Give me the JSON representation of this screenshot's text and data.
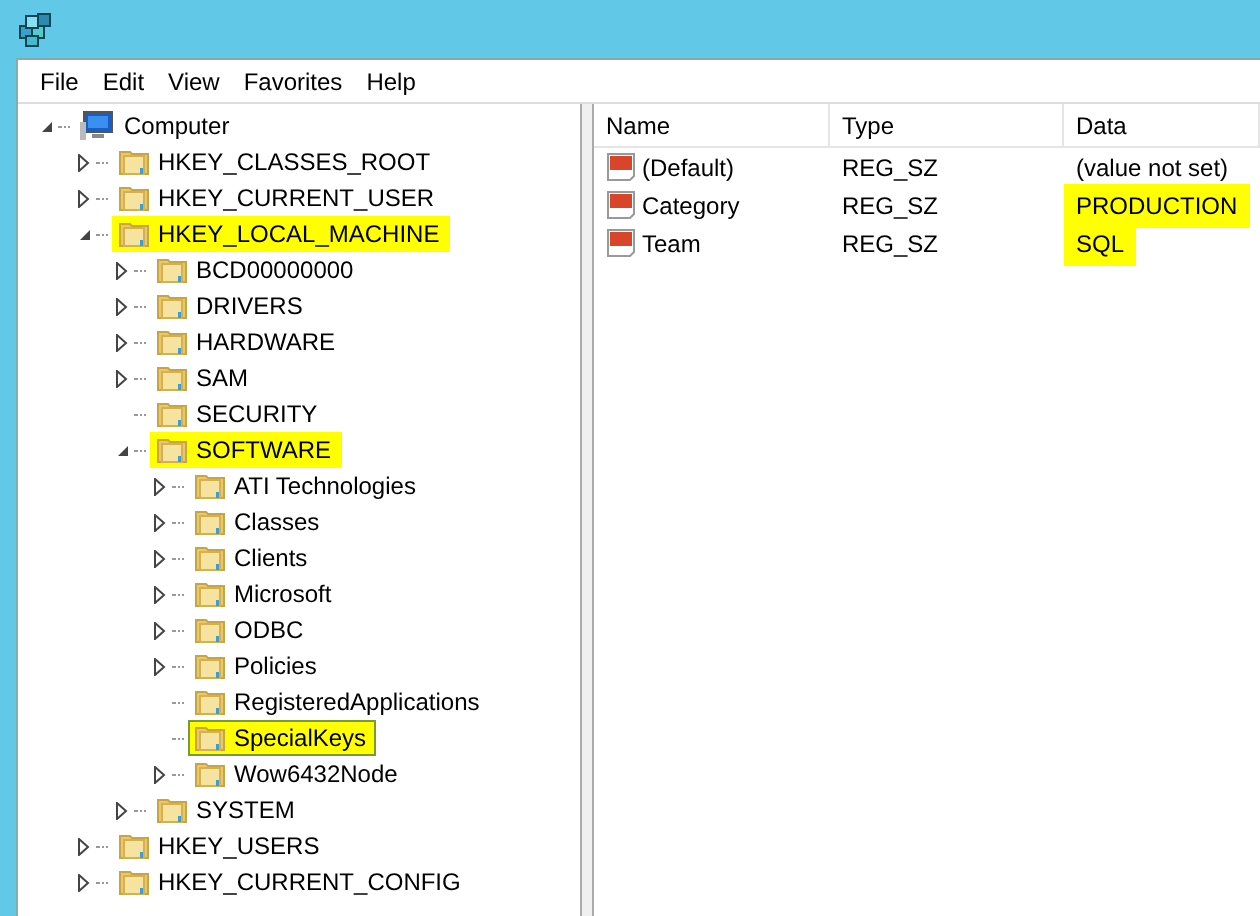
{
  "menu": [
    "File",
    "Edit",
    "View",
    "Favorites",
    "Help"
  ],
  "tree": [
    {
      "label": "Computer",
      "kind": "computer",
      "expanded": true,
      "selected": false,
      "highlighted": false,
      "children": [
        {
          "label": "HKEY_CLASSES_ROOT",
          "expanded": false,
          "selected": false,
          "highlighted": false
        },
        {
          "label": "HKEY_CURRENT_USER",
          "expanded": false,
          "selected": false,
          "highlighted": false
        },
        {
          "label": "HKEY_LOCAL_MACHINE",
          "expanded": true,
          "selected": false,
          "highlighted": true,
          "children": [
            {
              "label": "BCD00000000",
              "expanded": false,
              "selected": false,
              "highlighted": false
            },
            {
              "label": "DRIVERS",
              "expanded": false,
              "selected": false,
              "highlighted": false
            },
            {
              "label": "HARDWARE",
              "expanded": false,
              "selected": false,
              "highlighted": false
            },
            {
              "label": "SAM",
              "expanded": false,
              "selected": false,
              "highlighted": false
            },
            {
              "label": "SECURITY",
              "selected": false,
              "highlighted": false
            },
            {
              "label": "SOFTWARE",
              "expanded": true,
              "selected": false,
              "highlighted": true,
              "children": [
                {
                  "label": "ATI Technologies",
                  "expanded": false,
                  "selected": false,
                  "highlighted": false
                },
                {
                  "label": "Classes",
                  "expanded": false,
                  "selected": false,
                  "highlighted": false
                },
                {
                  "label": "Clients",
                  "expanded": false,
                  "selected": false,
                  "highlighted": false
                },
                {
                  "label": "Microsoft",
                  "expanded": false,
                  "selected": false,
                  "highlighted": false
                },
                {
                  "label": "ODBC",
                  "expanded": false,
                  "selected": false,
                  "highlighted": false
                },
                {
                  "label": "Policies",
                  "expanded": false,
                  "selected": false,
                  "highlighted": false
                },
                {
                  "label": "RegisteredApplications",
                  "selected": false,
                  "highlighted": false
                },
                {
                  "label": "SpecialKeys",
                  "selected": true,
                  "highlighted": true
                },
                {
                  "label": "Wow6432Node",
                  "expanded": false,
                  "selected": false,
                  "highlighted": false
                }
              ]
            },
            {
              "label": "SYSTEM",
              "expanded": false,
              "selected": false,
              "highlighted": false
            }
          ]
        },
        {
          "label": "HKEY_USERS",
          "expanded": false,
          "selected": false,
          "highlighted": false
        },
        {
          "label": "HKEY_CURRENT_CONFIG",
          "expanded": false,
          "selected": false,
          "highlighted": false
        }
      ]
    }
  ],
  "table": {
    "columns": [
      "Name",
      "Type",
      "Data"
    ],
    "rows": [
      {
        "name": "(Default)",
        "type": "REG_SZ",
        "data": "(value not set)",
        "highlighted": false
      },
      {
        "name": "Category",
        "type": "REG_SZ",
        "data": "PRODUCTION",
        "highlighted": true
      },
      {
        "name": "Team",
        "type": "REG_SZ",
        "data": "SQL",
        "highlighted": true
      }
    ]
  }
}
